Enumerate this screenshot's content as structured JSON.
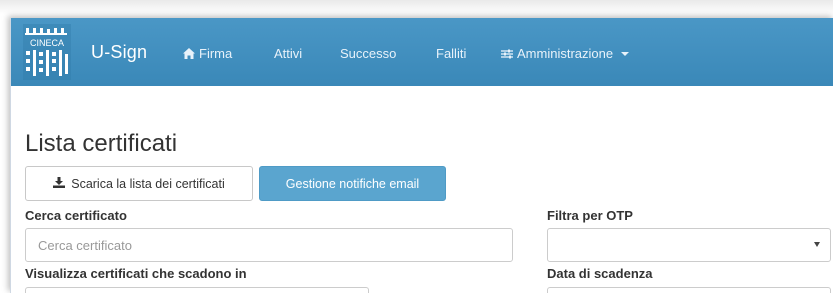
{
  "app": {
    "logo_text": "CINECA",
    "brand": "U-Sign"
  },
  "nav": {
    "items": [
      {
        "label": "Firma",
        "icon": "home-icon"
      },
      {
        "label": "Attivi"
      },
      {
        "label": "Successo"
      },
      {
        "label": "Falliti"
      },
      {
        "label": "Amministrazione",
        "icon": "sliders-icon",
        "dropdown": true
      }
    ]
  },
  "page": {
    "title": "Lista certificati"
  },
  "actions": {
    "download_label": "Scarica la lista dei certificati",
    "download_icon": "download-icon",
    "notifications_label": "Gestione notifiche email"
  },
  "filters": {
    "search_label": "Cerca certificato",
    "search_placeholder": "Cerca certificato",
    "otp_label": "Filtra per OTP",
    "otp_value": "",
    "expiring_label": "Visualizza certificati che scadono in",
    "expiry_date_label": "Data di scadenza"
  },
  "colors": {
    "navbar": "#3c8dbc",
    "primary_button": "#5aa5cf"
  }
}
